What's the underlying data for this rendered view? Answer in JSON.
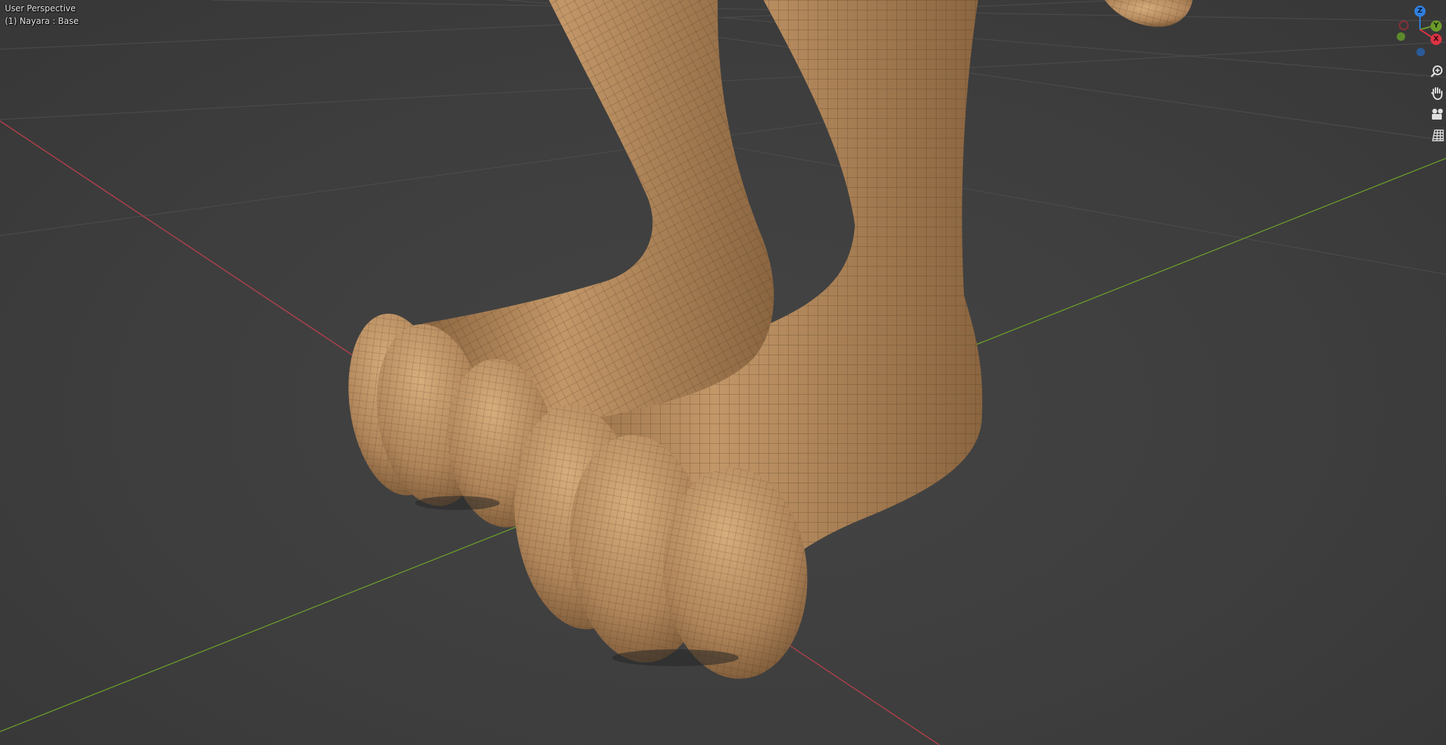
{
  "viewport": {
    "view_label": "User Perspective",
    "object_label": "(1) Nayara : Base"
  },
  "gizmo": {
    "axes": [
      {
        "name": "Z",
        "color": "#2f7fdd"
      },
      {
        "name": "Y",
        "color": "#6b9a2a"
      },
      {
        "name": "X",
        "color": "#dd3344"
      }
    ],
    "negative_axes": [
      {
        "name": "-X",
        "color": "#8a3038"
      },
      {
        "name": "-Y",
        "color": "#5c8a2a"
      },
      {
        "name": "-Z",
        "color": "#2a5a99"
      }
    ]
  },
  "nav_tools": [
    {
      "name": "zoom-icon"
    },
    {
      "name": "hand-pan-icon"
    },
    {
      "name": "camera-icon"
    },
    {
      "name": "grid-ortho-icon"
    }
  ],
  "colors": {
    "background": "#3d3d3d",
    "grid_line": "#4a4a4a",
    "x_axis": "#b5404a",
    "y_axis": "#6a9a2a",
    "mesh_base": "#b58a5a",
    "mesh_wire": "#3a2a18"
  }
}
